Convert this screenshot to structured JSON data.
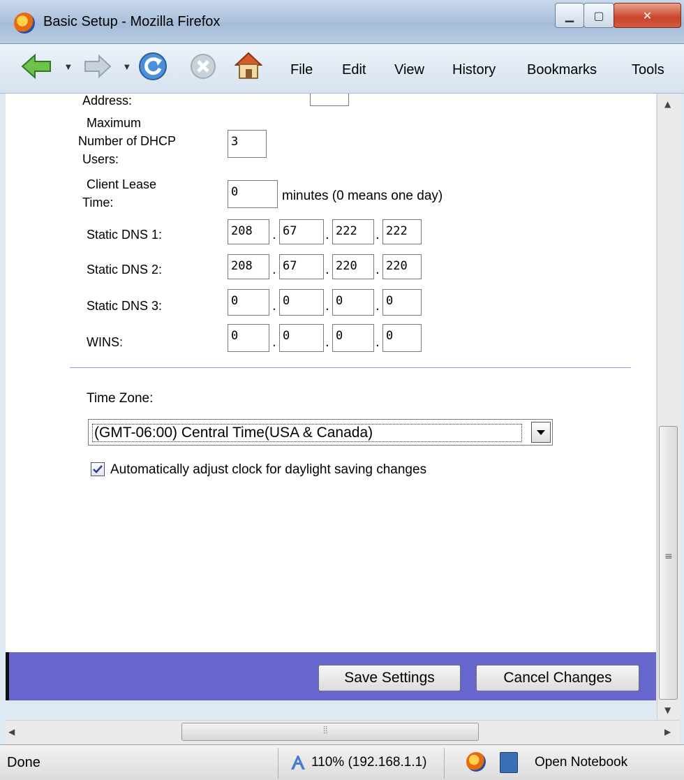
{
  "window": {
    "title": "Basic Setup - Mozilla Firefox"
  },
  "menu": {
    "items": [
      "File",
      "Edit",
      "View",
      "History",
      "Bookmarks",
      "Tools"
    ]
  },
  "form": {
    "start_address_label": "Address:",
    "max_users_label_1": "Maximum",
    "max_users_label_2": "Number of  DHCP",
    "max_users_label_3": "Users:",
    "max_users_value": "3",
    "lease_label_1": "Client Lease",
    "lease_label_2": "Time:",
    "lease_value": "0",
    "lease_hint": "minutes (0 means one day)",
    "dns1_label": "Static DNS 1:",
    "dns1": [
      "208",
      "67",
      "222",
      "222"
    ],
    "dns2_label": "Static DNS 2:",
    "dns2": [
      "208",
      "67",
      "220",
      "220"
    ],
    "dns3_label": "Static DNS 3:",
    "dns3": [
      "0",
      "0",
      "0",
      "0"
    ],
    "wins_label": "WINS:",
    "wins": [
      "0",
      "0",
      "0",
      "0"
    ],
    "timezone_label": "Time Zone:",
    "timezone_value": "(GMT-06:00) Central Time(USA & Canada)",
    "dst_label": "Automatically adjust clock for daylight saving changes",
    "dst_checked": true,
    "save_label": "Save Settings",
    "cancel_label": "Cancel Changes"
  },
  "status": {
    "text": "Done",
    "zoom": "110% (192.168.1.1)",
    "notebook": "Open Notebook"
  },
  "colors": {
    "bottom_bar": "#6666cc",
    "divider": "#9a98d6"
  }
}
